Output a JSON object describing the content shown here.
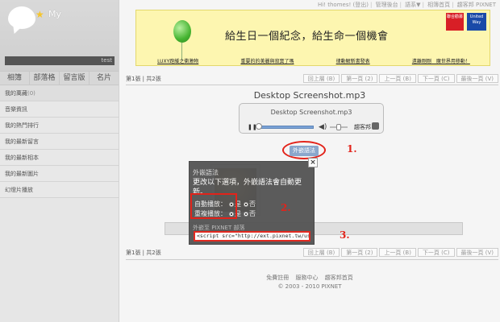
{
  "sidebar": {
    "title": "My",
    "search_label": "test",
    "tabs": [
      "相簿",
      "部落格",
      "留言版",
      "名片"
    ],
    "items": [
      {
        "label": "我的萬藏",
        "count": "(0)"
      },
      {
        "label": "音樂資訊",
        "count": ""
      },
      {
        "label": "我的熱門排行",
        "count": ""
      },
      {
        "label": "我的最新留言",
        "count": ""
      },
      {
        "label": "我的最新相本",
        "count": ""
      },
      {
        "label": "我的最新圖片",
        "count": ""
      },
      {
        "label": "幻燈片播放",
        "count": ""
      }
    ]
  },
  "topnav": [
    "Hi! thomes! (登出)",
    "管理後台",
    "語系▼",
    "相簿首頁",
    "趨客邦 PIXNET"
  ],
  "banner": {
    "text": "給生日一個紀念，給生命一個機會",
    "logo1": "聯合勸募",
    "logo2": "United Way",
    "links": [
      "LUXY跑緩之衝激物",
      "重要的的美麗與寂寞了嗎",
      "律動解新書發表",
      "遠離剛剛　魔世界用移動！"
    ]
  },
  "pager": {
    "info": "第1張 | 共2張",
    "buttons": [
      "回上層 (B)",
      "第一頁 (2)",
      "上一頁 (B)",
      "下一頁 (C)",
      "最後一頁 (V)"
    ]
  },
  "track": {
    "title": "Desktop Screenshot.mp3",
    "player_name": "Desktop Screenshot.mp3",
    "share_label": "趨客邦",
    "progress": 0.05
  },
  "embed_button": "外嵌語法",
  "annotations": [
    "1.",
    "2.",
    "3."
  ],
  "popup": {
    "close": "×",
    "title": "外嵌語法",
    "desc": "更改以下選項，外嵌語法會自動更新。",
    "autoplay_label": "自動播放：",
    "loop_label": "重複播放：",
    "yes": "是",
    "no": "否",
    "section": "外嵌至 PIXNET 部落",
    "code": "<script src=\"http://ext.pixnet.tw/user/thome"
  },
  "footer": {
    "links": [
      "免費註冊",
      "服務中心",
      "趨客邦首頁"
    ],
    "copyright": "© 2003 - 2010 PIXNET"
  },
  "colors": {
    "annotation_red": "#e2231a",
    "embed_button": "#8aa7cc",
    "popup_bg": "#555555"
  }
}
